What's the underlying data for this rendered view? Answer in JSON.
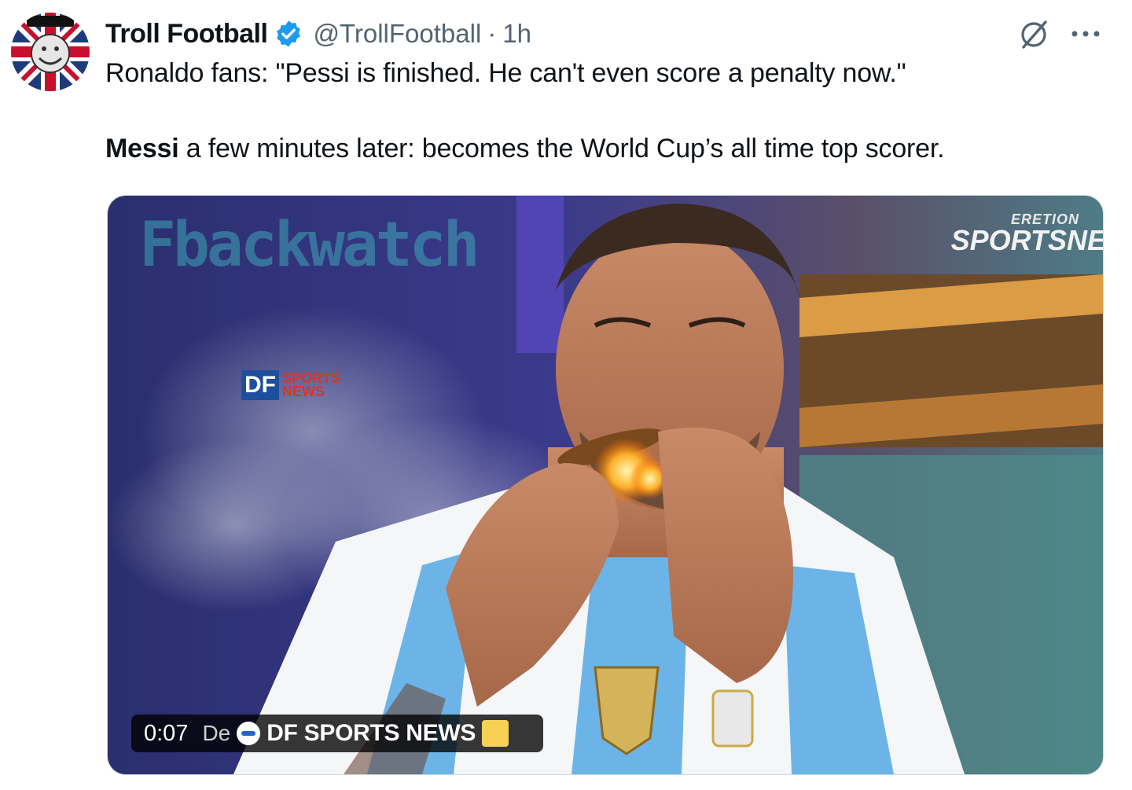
{
  "tweet": {
    "display_name": "Troll Football",
    "handle": "@TrollFootball",
    "separator": "·",
    "time": "1h",
    "line1": "Ronaldo fans: \"Pessi is finished. He can't even score a penalty now.\"",
    "line2_bold": "Messi",
    "line2_rest": " a few minutes later: becomes the World Cup’s all time top scorer.",
    "more_label": "···",
    "avatar_icon": "troll-face-union-jack-avatar",
    "verified_icon": "verified-badge-icon",
    "grok_icon": "grok-icon",
    "colors": {
      "verified": "#1d9bf0",
      "secondary_text": "#536471"
    }
  },
  "media": {
    "brand_top": "Fbackwatch",
    "channel_small": "ERETION",
    "channel_big": "SPORTSNE",
    "watermark_df": "DF",
    "watermark_line1": "SPORTS",
    "watermark_line2": "NEWS",
    "overlay": {
      "time": "0:07",
      "de": "De",
      "source": "DF SPORTS NEWS"
    }
  }
}
